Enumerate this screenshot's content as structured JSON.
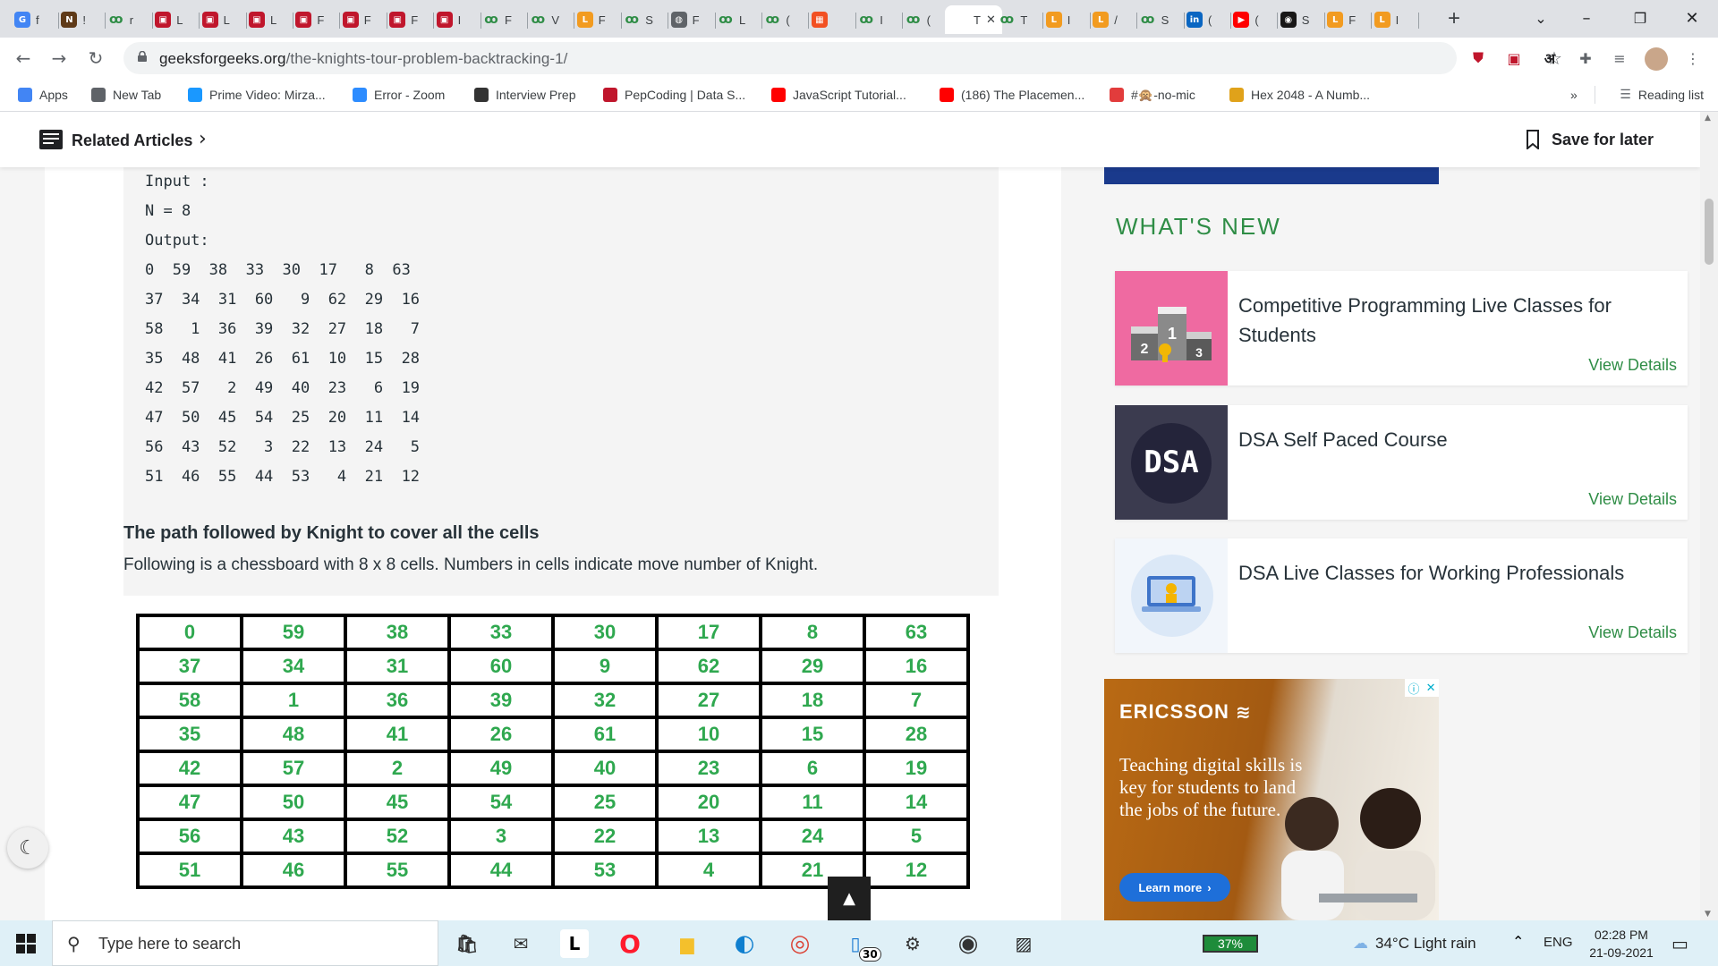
{
  "browser": {
    "tabs": [
      {
        "label": "f",
        "icon": "google-icon",
        "color": "#4285f4",
        "glyph": "G"
      },
      {
        "label": "!",
        "icon": "news-icon",
        "color": "#5f3a18",
        "glyph": "N"
      },
      {
        "label": "r",
        "icon": "gfg-icon",
        "color": "#2f8d46",
        "glyph": "ꝏ"
      },
      {
        "label": "L",
        "icon": "pepcoding-icon",
        "color": "#c0162c",
        "glyph": "▣"
      },
      {
        "label": "L",
        "icon": "pepcoding-icon",
        "color": "#c0162c",
        "glyph": "▣"
      },
      {
        "label": "L",
        "icon": "pepcoding-icon",
        "color": "#c0162c",
        "glyph": "▣"
      },
      {
        "label": "F",
        "icon": "pepcoding-icon",
        "color": "#c0162c",
        "glyph": "▣"
      },
      {
        "label": "F",
        "icon": "pepcoding-icon",
        "color": "#c0162c",
        "glyph": "▣"
      },
      {
        "label": "F",
        "icon": "pepcoding-icon",
        "color": "#c0162c",
        "glyph": "▣"
      },
      {
        "label": "I",
        "icon": "pepcoding-icon",
        "color": "#c0162c",
        "glyph": "▣"
      },
      {
        "label": "F",
        "icon": "gfg-icon",
        "color": "#2f8d46",
        "glyph": "ꝏ"
      },
      {
        "label": "V",
        "icon": "gfg-icon",
        "color": "#2f8d46",
        "glyph": "ꝏ"
      },
      {
        "label": "F",
        "icon": "leetcode-icon",
        "color": "#f29b20",
        "glyph": "L"
      },
      {
        "label": "S",
        "icon": "gfg-icon",
        "color": "#2f8d46",
        "glyph": "ꝏ"
      },
      {
        "label": "F",
        "icon": "globe-icon",
        "color": "#5f6368",
        "glyph": "◍"
      },
      {
        "label": "L",
        "icon": "gfg-icon",
        "color": "#2f8d46",
        "glyph": "ꝏ"
      },
      {
        "label": "(",
        "icon": "gfg-icon",
        "color": "#2f8d46",
        "glyph": "ꝏ"
      },
      {
        "label": "",
        "icon": "microsoft-icon",
        "color": "#f25022",
        "glyph": "▦"
      },
      {
        "label": "I",
        "icon": "gfg-icon",
        "color": "#2f8d46",
        "glyph": "ꝏ"
      },
      {
        "label": "(",
        "icon": "gfg-icon",
        "color": "#2f8d46",
        "glyph": "ꝏ"
      },
      {
        "label": "T",
        "icon": "gfg-icon",
        "color": "#2f8d46",
        "glyph": ""
      },
      {
        "label": "T",
        "icon": "gfg-icon",
        "color": "#2f8d46",
        "glyph": "ꝏ"
      },
      {
        "label": "I",
        "icon": "leetcode-icon",
        "color": "#f29b20",
        "glyph": "L"
      },
      {
        "label": "/",
        "icon": "leetcode-icon",
        "color": "#f29b20",
        "glyph": "L"
      },
      {
        "label": "S",
        "icon": "gfg-icon",
        "color": "#2f8d46",
        "glyph": "ꝏ"
      },
      {
        "label": "(",
        "icon": "linkedin-icon",
        "color": "#0a66c2",
        "glyph": "in"
      },
      {
        "label": "(",
        "icon": "youtube-icon",
        "color": "#ff0000",
        "glyph": "▶"
      },
      {
        "label": "S",
        "icon": "github-icon",
        "color": "#181717",
        "glyph": "◉"
      },
      {
        "label": "F",
        "icon": "leetcode-icon",
        "color": "#f29b20",
        "glyph": "L"
      },
      {
        "label": "I",
        "icon": "leetcode-icon",
        "color": "#f29b20",
        "glyph": "L"
      }
    ],
    "active_tab": 20,
    "url_host": "geeksforgeeks.org",
    "url_path": "/the-knights-tour-problem-backtracking-1/",
    "bookmarks": [
      {
        "label": "Apps",
        "icon": "apps-grid-icon",
        "color": "#4285f4"
      },
      {
        "label": "New Tab",
        "icon": "globe-icon",
        "color": "#5f6368"
      },
      {
        "label": "Prime Video: Mirza...",
        "icon": "prime-video-icon",
        "color": "#1a98ff"
      },
      {
        "label": "Error - Zoom",
        "icon": "zoom-icon",
        "color": "#2d8cff"
      },
      {
        "label": "Interview Prep",
        "icon": "td-icon",
        "color": "#333333"
      },
      {
        "label": "PepCoding | Data S...",
        "icon": "pepcoding-icon",
        "color": "#c0162c"
      },
      {
        "label": "JavaScript Tutorial...",
        "icon": "youtube-icon",
        "color": "#ff0000"
      },
      {
        "label": "(186) The Placemen...",
        "icon": "youtube-icon",
        "color": "#ff0000"
      },
      {
        "label": "#🙊-no-mic",
        "icon": "discord-icon",
        "color": "#e23c3c"
      },
      {
        "label": "Hex 2048 - A Numb...",
        "icon": "hex-game-icon",
        "color": "#e0a21a"
      }
    ],
    "bookmarks_more": "»",
    "reading_list": "Reading list"
  },
  "page": {
    "related_articles": "Related Articles",
    "save_for_later": "Save for later",
    "code_text": "Input : \nN = 8\nOutput:\n0  59  38  33  30  17   8  63\n37  34  31  60   9  62  29  16\n58   1  36  39  32  27  18   7\n35  48  41  26  61  10  15  28\n42  57   2  49  40  23   6  19\n47  50  45  54  25  20  11  14\n56  43  52   3  22  13  24   5\n51  46  55  44  53   4  21  12",
    "subheading": "The path followed by Knight to cover all the cells",
    "description": "Following is a chessboard with 8 x 8 cells. Numbers in cells indicate move number of Knight.",
    "board": [
      [
        "0",
        "59",
        "38",
        "33",
        "30",
        "17",
        "8",
        "63"
      ],
      [
        "37",
        "34",
        "31",
        "60",
        "9",
        "62",
        "29",
        "16"
      ],
      [
        "58",
        "1",
        "36",
        "39",
        "32",
        "27",
        "18",
        "7"
      ],
      [
        "35",
        "48",
        "41",
        "26",
        "61",
        "10",
        "15",
        "28"
      ],
      [
        "42",
        "57",
        "2",
        "49",
        "40",
        "23",
        "6",
        "19"
      ],
      [
        "47",
        "50",
        "45",
        "54",
        "25",
        "20",
        "11",
        "14"
      ],
      [
        "56",
        "43",
        "52",
        "3",
        "22",
        "13",
        "24",
        "5"
      ],
      [
        "51",
        "46",
        "55",
        "44",
        "53",
        "4",
        "21",
        "12"
      ]
    ],
    "board_color": "#2fa84f",
    "back_to_top": "▲"
  },
  "sidebar": {
    "whats_new": "WHAT'S NEW",
    "cards": [
      {
        "title": "Competitive Programming Live Classes for Students",
        "link": "View Details",
        "thumb": "podium-thumb"
      },
      {
        "title": "DSA Self Paced Course",
        "link": "View Details",
        "thumb": "DSA"
      },
      {
        "title": "DSA Live Classes for Working Professionals",
        "link": "View Details",
        "thumb": "live-class-thumb"
      }
    ],
    "ad": {
      "brand": "ERICSSON",
      "text": "Teaching digital skills is key for students to land the jobs of the future.",
      "button": "Learn more"
    }
  },
  "taskbar": {
    "search_placeholder": "Type here to search",
    "badge_count": "30",
    "battery": "37%",
    "weather": "34°C  Light rain",
    "language": "ENG",
    "time": "02:28 PM",
    "date": "21-09-2021"
  }
}
